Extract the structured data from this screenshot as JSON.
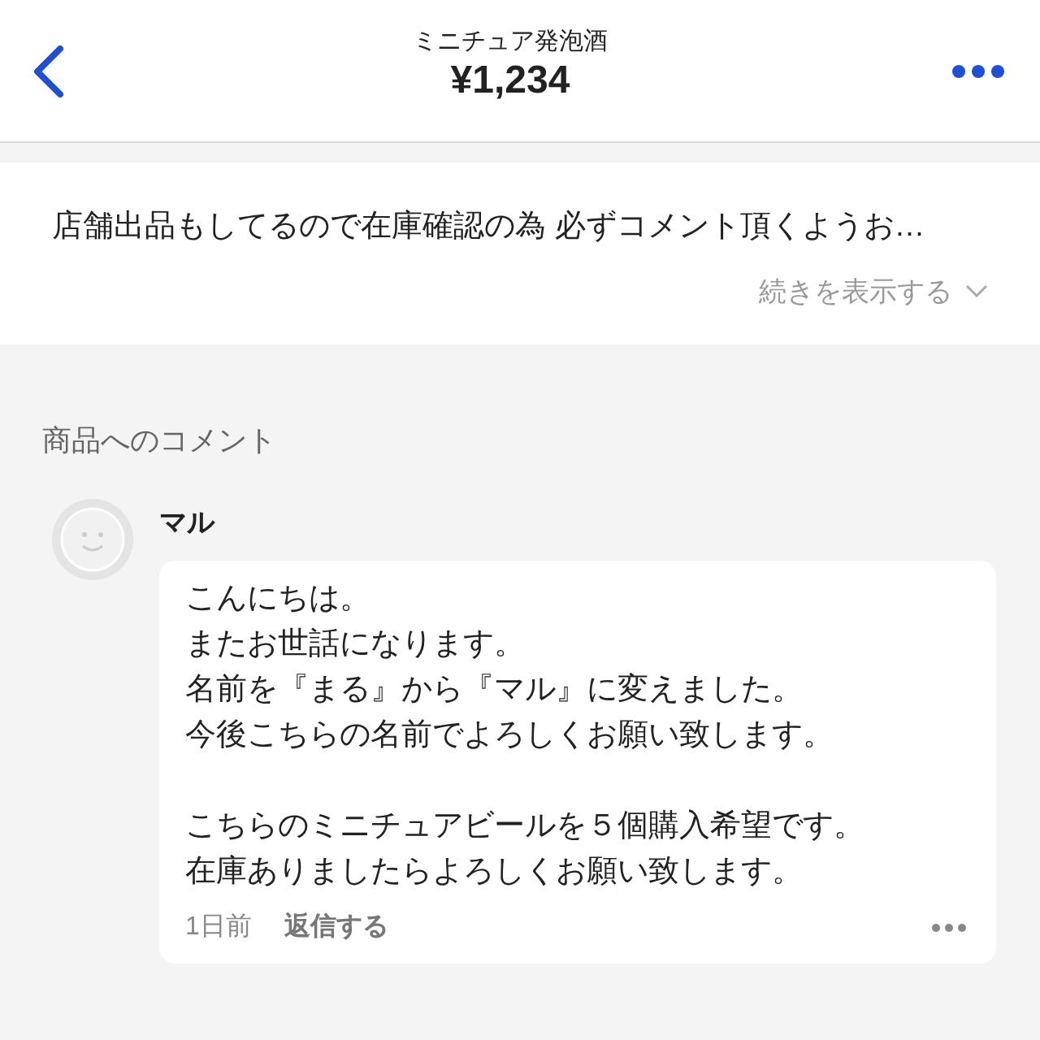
{
  "header": {
    "title": "ミニチュア発泡酒",
    "price": "¥1,234"
  },
  "description": {
    "text": "店舗出品もしてるので在庫確認の為 必ずコメント頂くようお…",
    "more": "続きを表示する"
  },
  "comments_section": {
    "heading": "商品へのコメント",
    "comments": [
      {
        "author": "マル",
        "paragraphs": [
          [
            "こんにちは。",
            "またお世話になります。",
            "名前を『まる』から『マル』に変えました。",
            "今後こちらの名前でよろしくお願い致します。"
          ],
          [
            "こちらのミニチュアビールを５個購入希望です。",
            "在庫ありましたらよろしくお願い致します。"
          ]
        ],
        "time": "1日前",
        "reply": "返信する"
      }
    ]
  }
}
